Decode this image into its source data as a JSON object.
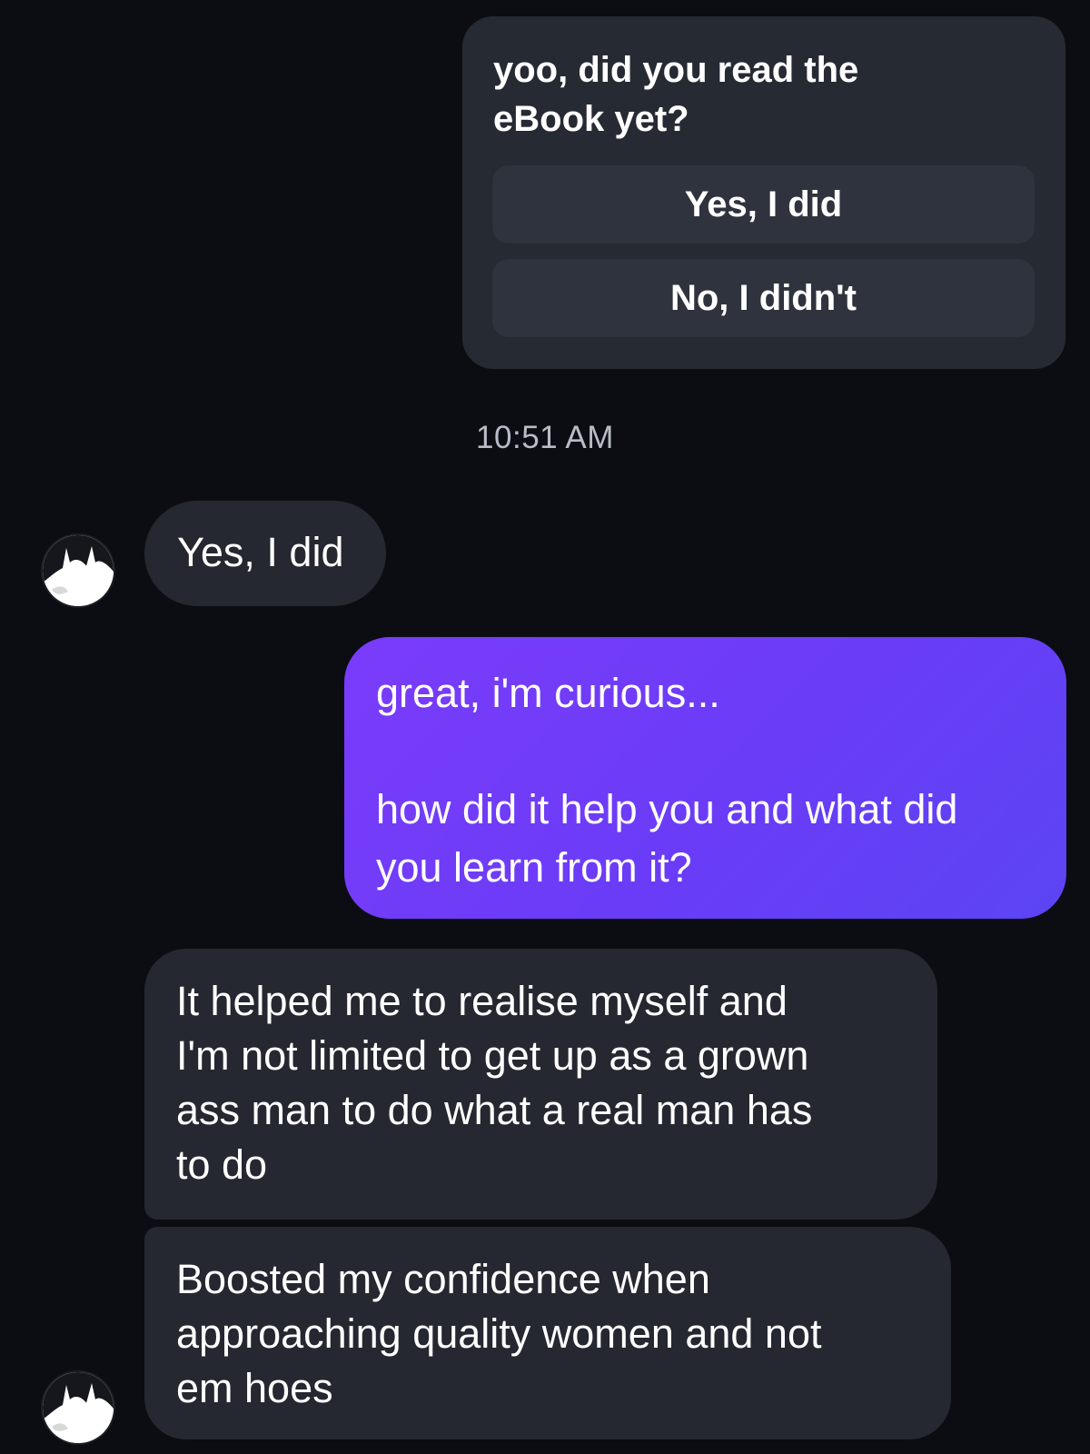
{
  "conversation": {
    "card": {
      "text": "yoo, did you read the\neBook yet?",
      "quick_replies": [
        "Yes, I did",
        "No, I didn't"
      ]
    },
    "timestamp": "10:51 AM",
    "messages": [
      {
        "direction": "incoming",
        "text": "Yes, I did"
      },
      {
        "direction": "outgoing",
        "text": "great, i'm curious...\n\nhow did it help you and what did\nyou learn from it?"
      },
      {
        "direction": "incoming",
        "text": "It helped me to realise myself and\nI'm  not limited to get up as a grown\nass man to do what a real man has\nto do"
      },
      {
        "direction": "incoming",
        "text": "Boosted my confidence  when\napproaching  quality women and not\nem hoes"
      }
    ]
  },
  "colors": {
    "background": "#0b0d12",
    "incoming_bubble": "#252830",
    "card": "#262a33",
    "quick_reply": "#2f333d",
    "outgoing_start": "#7a3cfa",
    "outgoing_end": "#5b45f3",
    "timestamp": "#b7bcc6"
  },
  "icons": {
    "avatar": "contact-avatar-icon"
  }
}
